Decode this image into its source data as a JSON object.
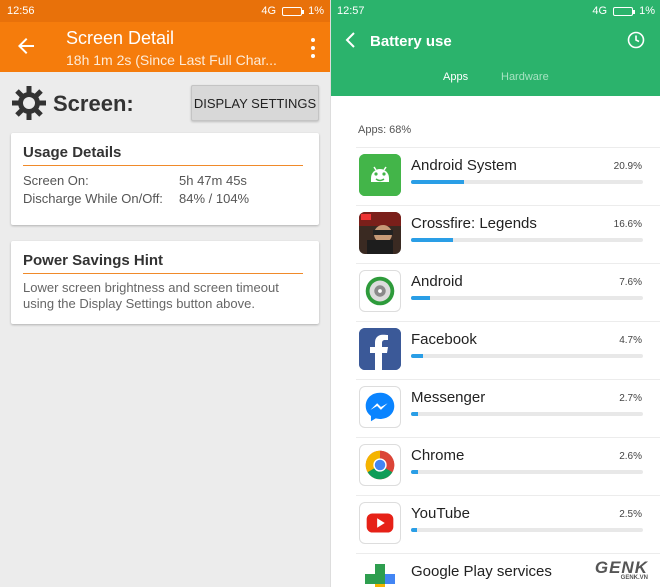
{
  "left": {
    "status_time": "12:56",
    "status_signal": "4G",
    "status_battery": "1%",
    "title": "Screen Detail",
    "subtitle": "18h 1m 2s (Since Last Full Char...",
    "section_label": "Screen:",
    "display_settings_button": "DISPLAY SETTINGS",
    "usage_card": {
      "title": "Usage Details",
      "rows": [
        {
          "label": "Screen On:",
          "value": "5h 47m 45s"
        },
        {
          "label": "Discharge While On/Off:",
          "value": "84% / 104%"
        }
      ]
    },
    "hint_card": {
      "title": "Power Savings Hint",
      "text": "Lower screen brightness and screen timeout using the Display Settings button above."
    },
    "accent_color": "#f57c0c"
  },
  "right": {
    "status_time": "12:57",
    "status_signal": "4G",
    "status_battery": "1%",
    "title": "Battery use",
    "tabs": [
      "Apps",
      "Hardware"
    ],
    "active_tab": "Apps",
    "apps_total": "Apps: 68%",
    "header_color": "#2bb36c",
    "bar_color": "#2a9ee6",
    "apps": [
      {
        "name": "Android System",
        "percent": "20.9%",
        "fraction": 0.209,
        "icon": "android-system-icon"
      },
      {
        "name": "Crossfire: Legends",
        "percent": "16.6%",
        "fraction": 0.166,
        "icon": "crossfire-legends-icon"
      },
      {
        "name": "Android",
        "percent": "7.6%",
        "fraction": 0.076,
        "icon": "android-icon"
      },
      {
        "name": "Facebook",
        "percent": "4.7%",
        "fraction": 0.047,
        "icon": "facebook-icon"
      },
      {
        "name": "Messenger",
        "percent": "2.7%",
        "fraction": 0.027,
        "icon": "messenger-icon"
      },
      {
        "name": "Chrome",
        "percent": "2.6%",
        "fraction": 0.026,
        "icon": "chrome-icon"
      },
      {
        "name": "YouTube",
        "percent": "2.5%",
        "fraction": 0.025,
        "icon": "youtube-icon"
      },
      {
        "name": "Google Play services",
        "percent": "",
        "fraction": 0.02,
        "icon": "google-play-services-icon"
      }
    ],
    "watermark": "GENK",
    "watermark_sub": "GENK.VN"
  }
}
